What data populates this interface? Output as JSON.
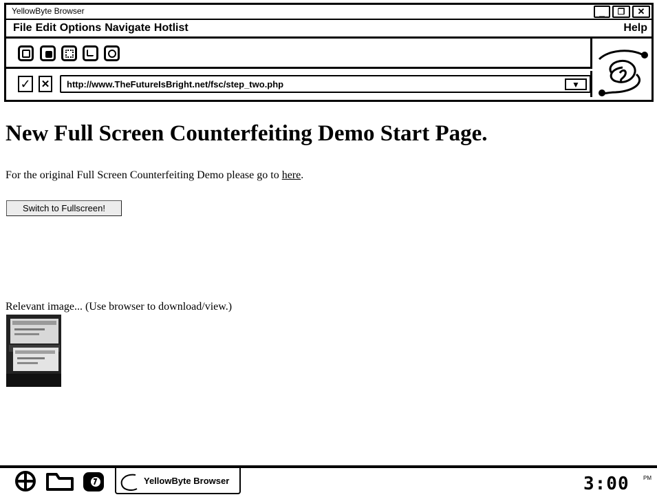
{
  "window": {
    "title": "YellowByte Browser",
    "controls": {
      "minimize": "_",
      "restore": "❐",
      "close": "✕"
    }
  },
  "menu": {
    "items": [
      "File",
      "Edit",
      "Options",
      "Navigate",
      "Hotlist"
    ],
    "help": "Help"
  },
  "toolbar": {
    "buttons": [
      "back-icon",
      "stop-icon",
      "reload-icon",
      "home-icon",
      "bookmark-icon"
    ]
  },
  "address": {
    "ok_label": "✓",
    "cancel_label": "✕",
    "url": "http://www.TheFutureIsBright.net/fsc/step_two.php",
    "dropdown": "▼"
  },
  "page": {
    "heading": "New Full Screen Counterfeiting Demo Start Page.",
    "intro_text": "For the original Full Screen Counterfeiting Demo please go to ",
    "intro_link": "here",
    "intro_end": ".",
    "fullscreen_button": "Switch to Fullscreen!",
    "image_caption": "Relevant image... (Use browser to download/view.)"
  },
  "taskbar": {
    "icons": [
      "start-icon",
      "folder-icon",
      "app-icon"
    ],
    "task_label": "YellowByte Browser",
    "clock": "3:00",
    "ampm": "PM"
  },
  "colors": {
    "ink": "#000000",
    "paper": "#ffffff",
    "button_face": "#ececec"
  }
}
